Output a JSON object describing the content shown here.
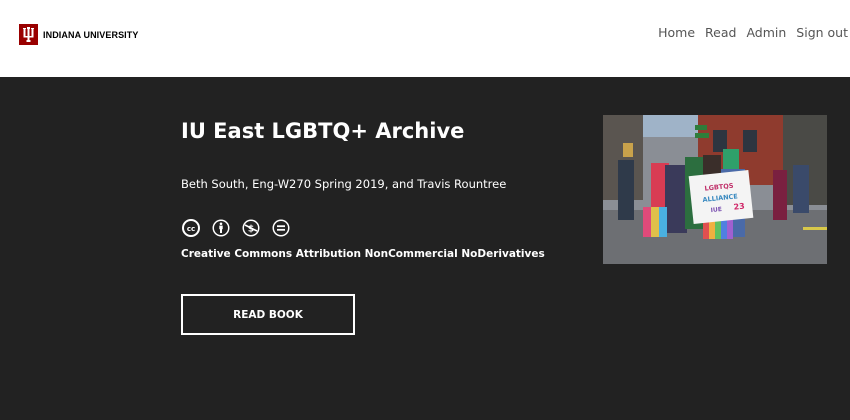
{
  "header": {
    "logo_text": "INDIANA UNIVERSITY",
    "nav": [
      "Home",
      "Read",
      "Admin",
      "Sign out"
    ]
  },
  "book": {
    "title": "IU East LGBTQ+ Archive",
    "authors": "Beth South, Eng-W270 Spring 2019, and Travis Rountree",
    "license": "Creative Commons Attribution NonCommercial NoDerivatives",
    "read_button": "READ BOOK",
    "cc_icons": [
      "cc-icon",
      "attribution-icon",
      "noncommercial-icon",
      "noderivatives-icon"
    ],
    "cover_sign": [
      "LGBTQS",
      "ALLIANCE",
      "IUE",
      "23"
    ]
  },
  "colors": {
    "brand": "#990000",
    "nav_text": "#555555",
    "hero_bg": "#222222"
  }
}
